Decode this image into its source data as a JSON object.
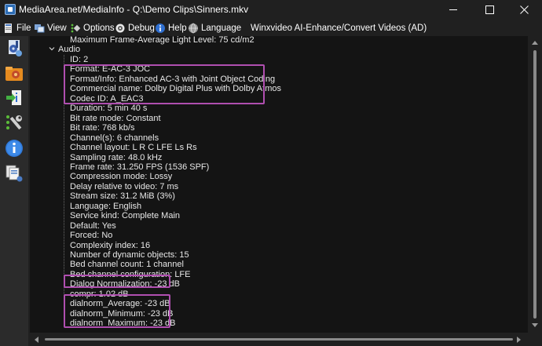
{
  "window": {
    "title": "MediaArea.net/MediaInfo - Q:\\Demo Clips\\Sinners.mkv"
  },
  "menu": {
    "file": "File",
    "view": "View",
    "options": "Options",
    "debug": "Debug",
    "help": "Help",
    "language": "Language",
    "winx": "Winxvideo AI-Enhance/Convert Videos (AD)"
  },
  "tree": {
    "top_line": "Maximum Frame-Average Light Level: 75 cd/m2",
    "section": "Audio",
    "lines": [
      "ID: 2",
      "Format: E-AC-3 JOC",
      "Format/Info: Enhanced AC-3 with Joint Object Coding",
      "Commercial name: Dolby Digital Plus with Dolby Atmos",
      "Codec ID: A_EAC3",
      "Duration: 5 min 40 s",
      "Bit rate mode: Constant",
      "Bit rate: 768 kb/s",
      "Channel(s): 6 channels",
      "Channel layout: L R C LFE Ls Rs",
      "Sampling rate: 48.0 kHz",
      "Frame rate: 31.250 FPS (1536 SPF)",
      "Compression mode: Lossy",
      "Delay relative to video: 7 ms",
      "Stream size: 31.2 MiB (3%)",
      "Language: English",
      "Service kind: Complete Main",
      "Default: Yes",
      "Forced: No",
      "Complexity index: 16",
      "Number of dynamic objects: 15",
      "Bed channel count: 1 channel",
      "Bed channel configuration: LFE",
      "Dialog Normalization: -23 dB",
      "compr: 1.02 dB",
      "dialnorm_Average: -23 dB",
      "dialnorm_Minimum: -23 dB",
      "dialnorm_Maximum: -23 dB"
    ]
  },
  "colors": {
    "background": "#202020",
    "content_background": "#141414",
    "highlight_border": "#b04fb0",
    "text": "#e8e8e8"
  }
}
